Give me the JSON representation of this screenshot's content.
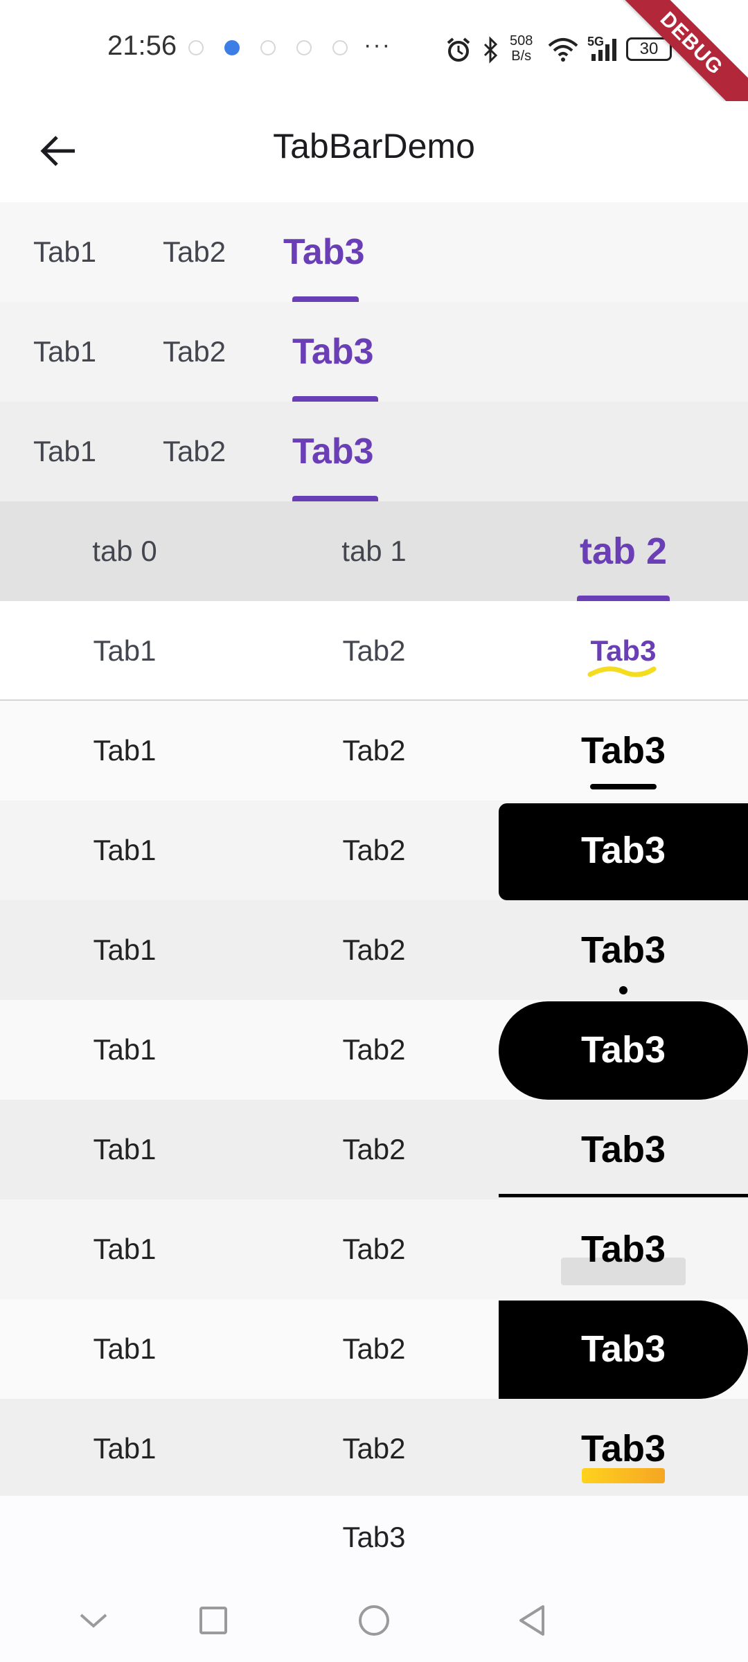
{
  "status_bar": {
    "time": "21:56",
    "more": "···",
    "net_speed_top": "508",
    "net_speed_bottom": "B/s",
    "network": "5G",
    "battery": "30",
    "debug_banner": "DEBUG"
  },
  "app_bar": {
    "title": "TabBarDemo"
  },
  "rows": [
    {
      "tabs": [
        "Tab1",
        "Tab2",
        "Tab3"
      ]
    },
    {
      "tabs": [
        "Tab1",
        "Tab2",
        "Tab3"
      ]
    },
    {
      "tabs": [
        "Tab1",
        "Tab2",
        "Tab3"
      ]
    },
    {
      "tabs": [
        "tab 0",
        "tab 1",
        "tab 2"
      ]
    },
    {
      "tabs": [
        "Tab1",
        "Tab2",
        "Tab3"
      ]
    },
    {
      "tabs": [
        "Tab1",
        "Tab2",
        "Tab3"
      ]
    },
    {
      "tabs": [
        "Tab1",
        "Tab2",
        "Tab3"
      ]
    },
    {
      "tabs": [
        "Tab1",
        "Tab2",
        "Tab3"
      ]
    },
    {
      "tabs": [
        "Tab1",
        "Tab2",
        "Tab3"
      ]
    },
    {
      "tabs": [
        "Tab1",
        "Tab2",
        "Tab3"
      ]
    },
    {
      "tabs": [
        "Tab1",
        "Tab2",
        "Tab3"
      ]
    },
    {
      "tabs": [
        "Tab1",
        "Tab2",
        "Tab3"
      ]
    },
    {
      "tabs": [
        "Tab1",
        "Tab2",
        "Tab3"
      ]
    }
  ],
  "footer_tab": "Tab3",
  "colors": {
    "accent": "#6a3fb6",
    "debug": "#b3273b",
    "gradient_start": "#ffd21e",
    "gradient_end": "#f5a623"
  },
  "icons": {
    "back": "arrow-back-icon",
    "nav_down": "chevron-down-icon",
    "nav_recent": "square-icon",
    "nav_home": "circle-icon",
    "nav_back": "triangle-back-icon"
  }
}
